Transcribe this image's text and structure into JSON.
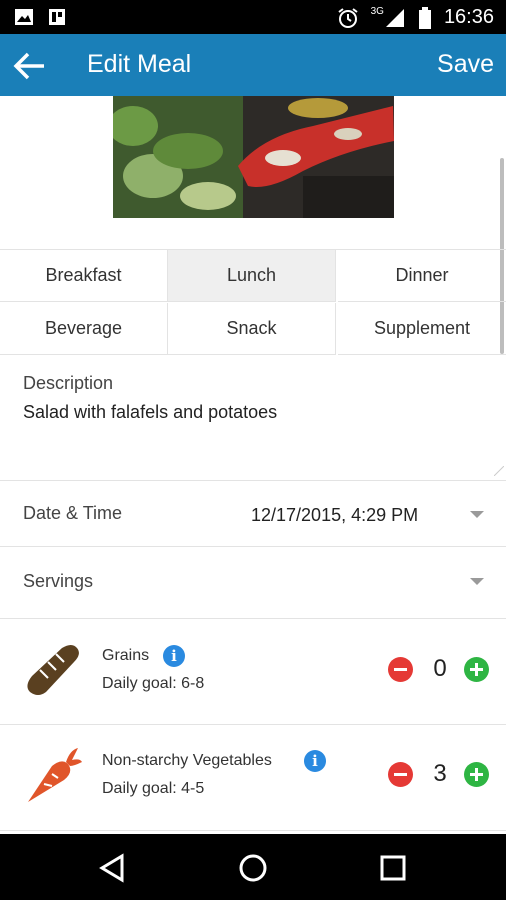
{
  "status_bar": {
    "network": "3G",
    "time": "16:36",
    "icons": [
      "image-icon",
      "grid-icon",
      "alarm-icon",
      "signal-icon",
      "battery-icon"
    ]
  },
  "app_bar": {
    "title": "Edit Meal",
    "save_label": "Save",
    "back_icon": "arrow-left-icon",
    "color": "#1a7fb8"
  },
  "photo": {
    "subject": "meal-photo"
  },
  "meal_types": {
    "options": [
      "Breakfast",
      "Lunch",
      "Dinner",
      "Beverage",
      "Snack",
      "Supplement"
    ],
    "selected": "Lunch"
  },
  "description": {
    "label": "Description",
    "value": "Salad with falafels and potatoes"
  },
  "date_time": {
    "label": "Date & Time",
    "value": "12/17/2015, 4:29 PM"
  },
  "servings": {
    "label": "Servings"
  },
  "food_groups": [
    {
      "name": "Grains",
      "goal": "Daily goal: 6-8",
      "count": "0",
      "icon": "bread-icon"
    },
    {
      "name": "Non-starchy Vegetables",
      "goal": "Daily goal: 4-5",
      "count": "3",
      "icon": "carrot-icon"
    }
  ],
  "colors": {
    "minus": "#e53935",
    "plus": "#2eb543",
    "info": "#2a8ae0"
  },
  "nav_bar": {
    "icons": [
      "back-triangle-icon",
      "home-circle-icon",
      "recents-square-icon"
    ]
  }
}
